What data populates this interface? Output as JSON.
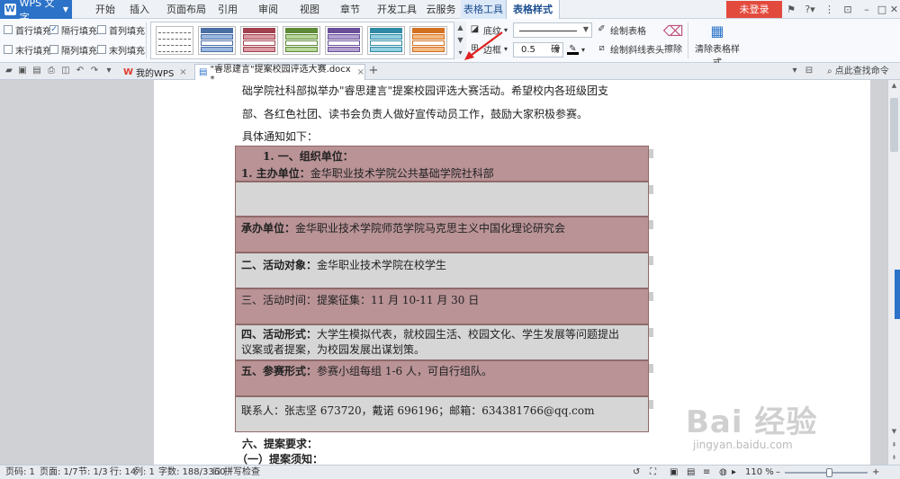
{
  "app": {
    "name": "WPS 文字",
    "login_label": "未登录"
  },
  "menu": {
    "tabs": [
      "开始",
      "插入",
      "页面布局",
      "引用",
      "审阅",
      "视图",
      "章节",
      "开发工具",
      "云服务",
      "表格工具",
      "表格样式"
    ],
    "active_tab": "表格样式"
  },
  "ribbon": {
    "checkboxes": [
      {
        "label": "首行填充",
        "checked": false
      },
      {
        "label": "隔行填充",
        "checked": true
      },
      {
        "label": "首列填充",
        "checked": false
      },
      {
        "label": "末行填充",
        "checked": false
      },
      {
        "label": "隔列填充",
        "checked": false
      },
      {
        "label": "末列填充",
        "checked": false
      }
    ],
    "style_swatches": [
      {
        "color": "#ffffff",
        "line": "#666666"
      },
      {
        "color": "#9ab7df",
        "line": "#4a6fa5"
      },
      {
        "color": "#d99aa3",
        "line": "#a3404f"
      },
      {
        "color": "#b6d69a",
        "line": "#5d8a35"
      },
      {
        "color": "#b3a1d0",
        "line": "#6a4f99"
      },
      {
        "color": "#94cfe0",
        "line": "#2f8aa6"
      },
      {
        "color": "#f5b984",
        "line": "#d3701f"
      }
    ],
    "shading_label": "底纹",
    "border_label": "边框",
    "line_width_value": "0.5",
    "line_width_unit": "磅",
    "draw_table_label": "绘制表格",
    "draw_diag_label": "绘制斜线表头",
    "erase_label": "擦除",
    "clear_style_label": "清除表格样式"
  },
  "tabs": {
    "mywps_label": "我的WPS",
    "doc_label": "\"睿思建言\"提案校园评选大赛.docx *",
    "search_label": "点此查找命令"
  },
  "document": {
    "lines": [
      "础学院社科部拟举办\"睿思建言\"提案校园评选大赛活动。希望校内各班级团支",
      "部、各红色社团、读书会负责人做好宣传动员工作，鼓励大家积极参赛。",
      "具体通知如下："
    ],
    "table": {
      "heading": "1.  一、组织单位：",
      "rows": [
        {
          "label": "1. 主办单位：",
          "text": "金华职业技术学院公共基础学院社科部",
          "style": "rose"
        },
        {
          "label": "",
          "text": "",
          "style": "grey"
        },
        {
          "label": "承办单位：",
          "text": "金华职业技术学院师范学院马克思主义中国化理论研究会",
          "style": "rose"
        },
        {
          "label": "二、活动对象：",
          "text": "金华职业技术学院在校学生",
          "style": "grey"
        },
        {
          "label": "三、活动时间：",
          "text": "提案征集：11 月 10-11 月 30 日",
          "style": "rose"
        },
        {
          "label": "四、活动形式：",
          "text": "大学生模拟代表，就校园生活、校园文化、学生发展等问题提出",
          "text2": "议案或者提案，为校园发展出谋划策。",
          "style": "grey"
        },
        {
          "label": "五、参赛形式：",
          "text": "参赛小组每组 1-6 人，可自行组队。",
          "style": "rose"
        },
        {
          "label": "",
          "text": "联系人：张志坚 673720，戴诺 696196；邮箱：634381766@qq.com",
          "style": "grey"
        }
      ]
    },
    "after_lines": [
      "六、提案要求：",
      "（一）提案须知："
    ]
  },
  "status": {
    "page_code": "页码: 1",
    "pages": "页面: 1/7",
    "section": "节: 1/3",
    "row": "行: 14",
    "col": "列: 1",
    "words": "字数: 188/3360",
    "spell": "拼写检查",
    "zoom": "110 %"
  },
  "watermark": {
    "main": "Bai 经验",
    "sub": "jingyan.baidu.com"
  },
  "colors": {
    "accent": "#2b72c8",
    "rose_row": "#b99396",
    "grey_row": "#d6d6d6",
    "login": "#e34a3e"
  }
}
